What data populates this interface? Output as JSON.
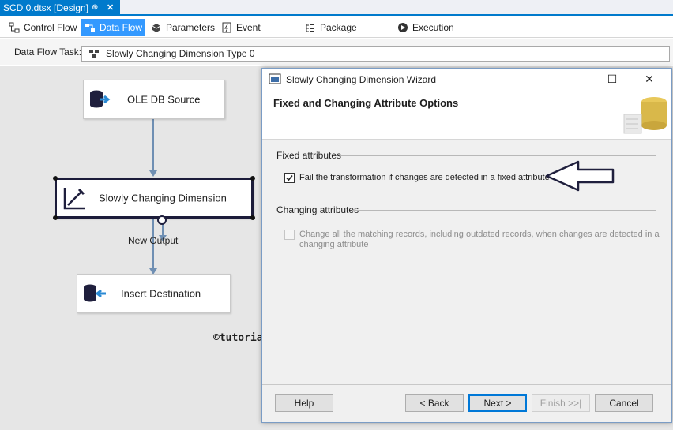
{
  "document_tab": {
    "title": "SCD 0.dtsx [Design]",
    "pin": "⊕",
    "close": "✕"
  },
  "designer_tabs": [
    {
      "label": "Control Flow"
    },
    {
      "label": "Data Flow"
    },
    {
      "label": "Parameters"
    },
    {
      "label": "Event Handlers"
    },
    {
      "label": "Package Explorer"
    },
    {
      "label": "Execution Results"
    }
  ],
  "task_row": {
    "label": "Data Flow Task:",
    "selected": "Slowly Changing Dimension Type 0"
  },
  "canvas": {
    "components": {
      "source": "OLE DB Source",
      "scd": "Slowly Changing Dimension",
      "destination": "Insert Destination"
    },
    "path_label": "New Output",
    "watermark": "©tutorialgateway.org"
  },
  "dialog": {
    "title": "Slowly Changing Dimension Wizard",
    "header": "Fixed and Changing Attribute Options",
    "fixed_group": "Fixed attributes",
    "fixed_checkbox": {
      "label": "Fail the transformation if changes are detected in a fixed attribute",
      "checked": true
    },
    "changing_group": "Changing attributes",
    "changing_checkbox": {
      "label": "Change all the matching records, including outdated records, when changes are detected in a changing attribute",
      "checked": false,
      "enabled": false
    },
    "buttons": {
      "help": "Help",
      "back": "< Back",
      "next": "Next >",
      "finish": "Finish >>|",
      "cancel": "Cancel"
    }
  },
  "colors": {
    "accent": "#007acc",
    "active_tab": "#3399ff",
    "canvas": "#e6e6e6"
  }
}
